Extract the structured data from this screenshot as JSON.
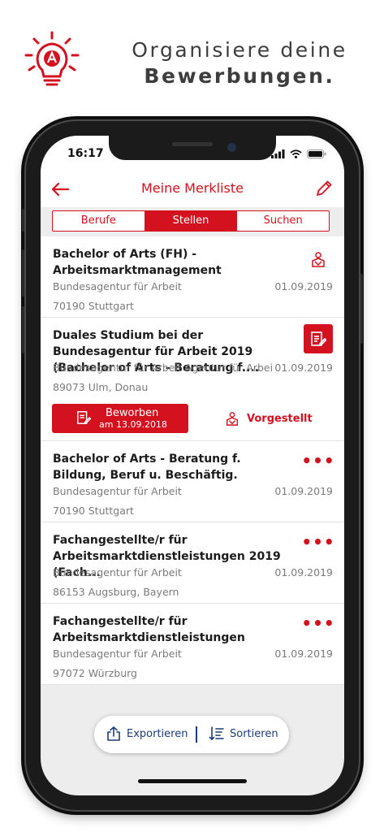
{
  "hero": {
    "icon": "lightbulb-logo-icon",
    "title_line1": "Organisiere deine",
    "title_line2": "Bewerbungen."
  },
  "status_bar": {
    "time": "16:17",
    "icons": [
      "cellular-icon",
      "wifi-icon",
      "battery-icon"
    ]
  },
  "navbar": {
    "title": "Meine Merkliste",
    "back_icon": "back-arrow-icon",
    "edit_icon": "pencil-icon"
  },
  "segments": [
    {
      "label": "Berufe",
      "active": false
    },
    {
      "label": "Stellen",
      "active": true
    },
    {
      "label": "Suchen",
      "active": false
    }
  ],
  "items": [
    {
      "title": "Bachelor of Arts (FH) - Arbeitsmarktmanagement",
      "company": "Bundesagentur für Arbeit",
      "date": "01.09.2019",
      "location": "70190 Stuttgart",
      "action": "presented-icon"
    },
    {
      "title": "Duales Studium bei der Bundesagentur für Arbeit 2019 (Bachelor of Arts - Beratung f....",
      "company": "Bundesagentur für Arbeit Agentur für Arbeit...",
      "date": "01.09.2019",
      "location": "89073 Ulm, Donau",
      "action": "applied-icon",
      "applied": {
        "label": "Beworben",
        "sub": "am 13.09.2018"
      },
      "presented": {
        "label": "Vorgestellt"
      }
    },
    {
      "title": "Bachelor of Arts - Beratung f. Bildung, Beruf u. Beschäftig.",
      "company": "Bundesagentur für Arbeit",
      "date": "01.09.2019",
      "location": "70190 Stuttgart",
      "action": "more-icon",
      "more": "•••"
    },
    {
      "title": "Fachangestellte/r für Arbeitsmarktdienstleistungen 2019 (Fach...",
      "company": "Bundesagentur für Arbeit",
      "date": "01.09.2019",
      "location": "86153 Augsburg, Bayern",
      "action": "more-icon",
      "more": "•••"
    },
    {
      "title": "Fachangestellte/r für Arbeitsmarktdienstleistungen",
      "company": "Bundesagentur für Arbeit",
      "date": "01.09.2019",
      "location": "97072 Würzburg",
      "action": "more-icon",
      "more": "•••"
    }
  ],
  "bottom_bar": {
    "export_label": "Exportieren",
    "sort_label": "Sortieren"
  },
  "colors": {
    "accent": "#d4111f",
    "pill_text": "#1d3b7a"
  }
}
